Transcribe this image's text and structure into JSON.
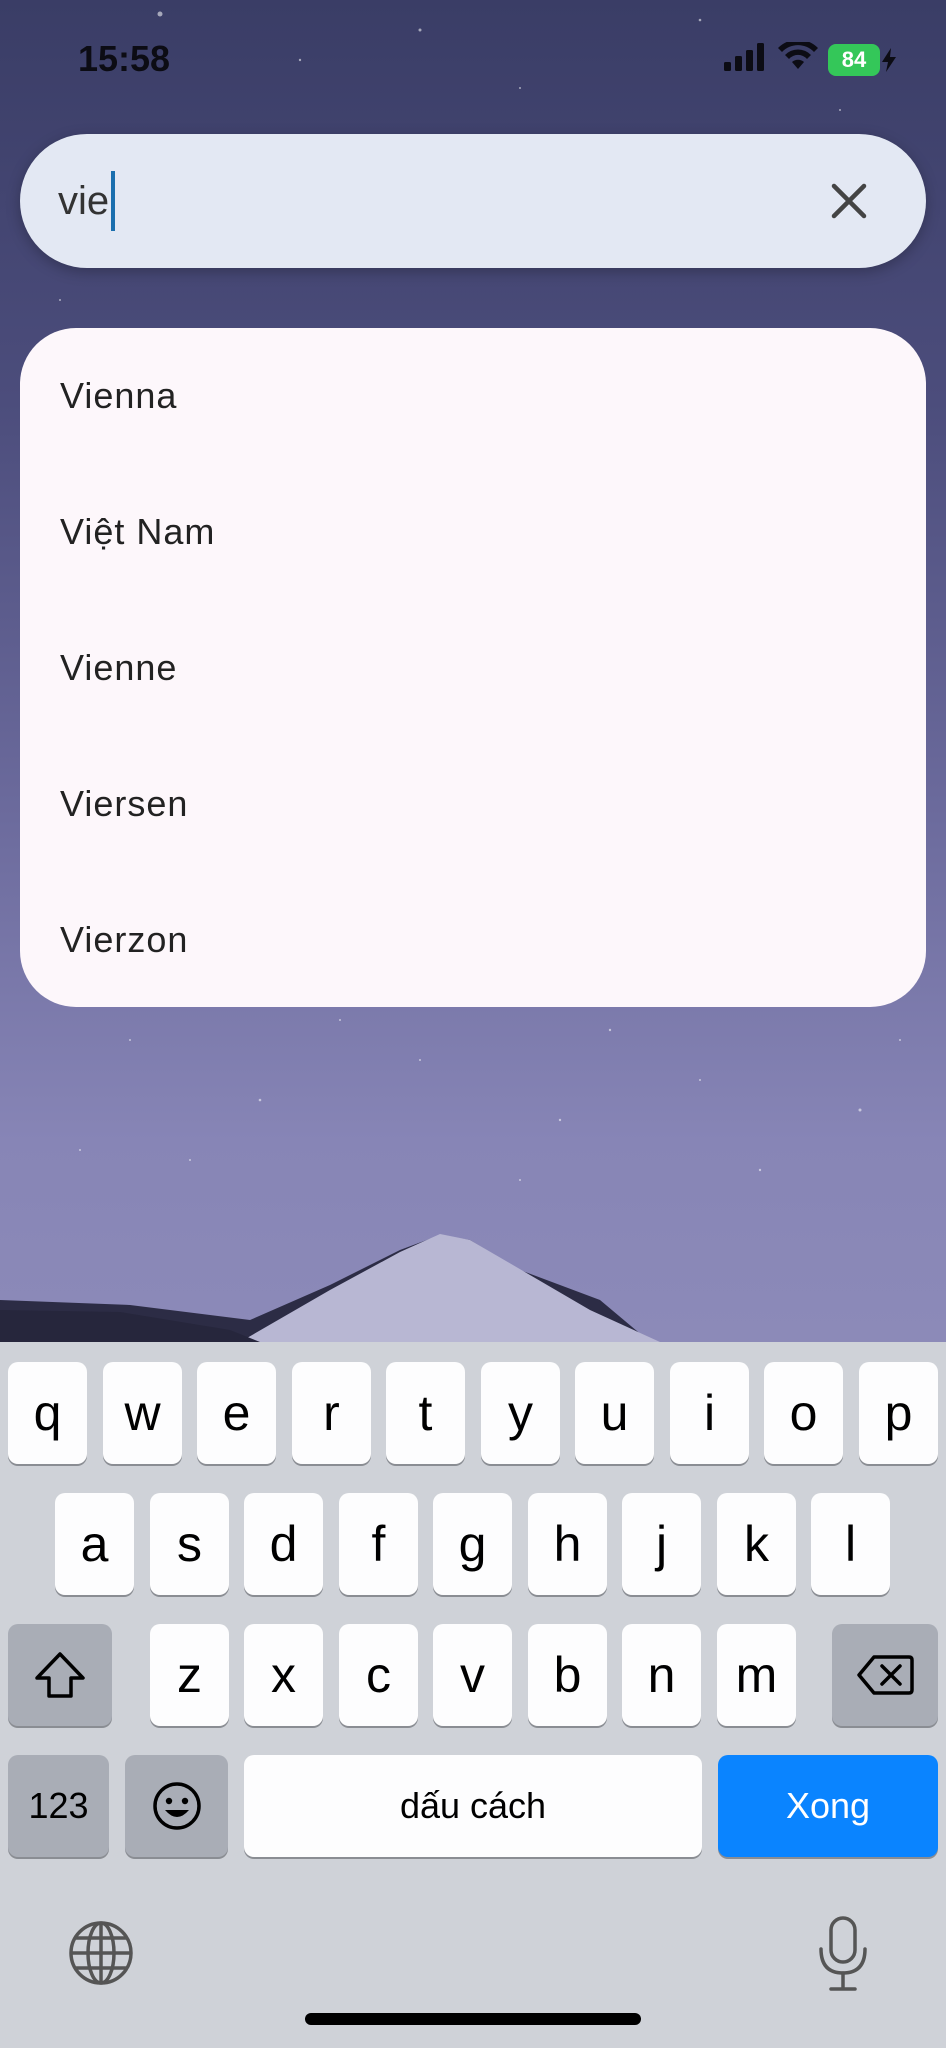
{
  "status_bar": {
    "time": "15:58",
    "battery": "84",
    "icons": [
      "signal-icon",
      "wifi-icon",
      "battery-charging-icon"
    ]
  },
  "search": {
    "value": "vie",
    "clear_icon": "close-icon"
  },
  "suggestions": [
    "Vienna",
    "Việt Nam",
    "Vienne",
    "Viersen",
    "Vierzon"
  ],
  "keyboard": {
    "row1": [
      "q",
      "w",
      "e",
      "r",
      "t",
      "y",
      "u",
      "i",
      "o",
      "p"
    ],
    "row2": [
      "a",
      "s",
      "d",
      "f",
      "g",
      "h",
      "j",
      "k",
      "l"
    ],
    "row3": [
      "z",
      "x",
      "c",
      "v",
      "b",
      "n",
      "m"
    ],
    "shift_icon": "shift-icon",
    "delete_icon": "delete-icon",
    "numbers_label": "123",
    "emoji_icon": "emoji-icon",
    "space_label": "dấu cách",
    "done_label": "Xong",
    "globe_icon": "globe-icon",
    "mic_icon": "microphone-icon"
  },
  "colors": {
    "accent": "#0a84ff",
    "caret": "#1b6fae",
    "battery": "#34c759",
    "keyboard_bg": "#cfd2d8",
    "search_bg": "#e3e8f3",
    "panel_bg": "#fdf7fb"
  }
}
